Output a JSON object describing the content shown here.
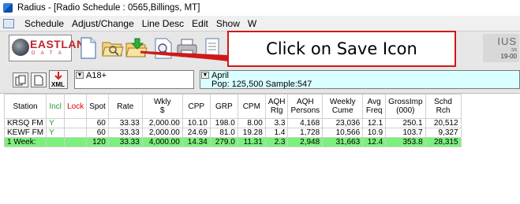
{
  "window": {
    "title": "Radius  - [Radio Schedule : 0565,Billings, MT]"
  },
  "menu": [
    "Schedule",
    "Adjust/Change",
    "Line Desc",
    "Edit",
    "Show",
    "W"
  ],
  "toolbar": {
    "logo_name": "EASTLAN",
    "logo_sub": "D A T A",
    "right_logo_l1": "IUS",
    "right_logo_l2": "ss",
    "right_logo_l3": "19-00",
    "icons": [
      "new-document-icon",
      "open-folder-icon",
      "save-folder-icon",
      "print-preview-icon",
      "print-icon",
      "report-icon"
    ]
  },
  "callout": {
    "text": "Click on Save Icon",
    "color": "#d01818"
  },
  "filter": {
    "demo": "A18+",
    "period": "April",
    "population": "Pop: 125,500   Sample:547"
  },
  "table": {
    "columns": [
      "Station",
      "Incl",
      "Lock",
      "Spot",
      "Rate",
      "Wkly\n$",
      "CPP",
      "GRP",
      "CPM",
      "AQH\nRtg",
      "AQH\nPersons",
      "Weekly\nCume",
      "Avg\nFreq",
      "GrossImp\n(000)",
      "Schd\nRch"
    ],
    "rows": [
      [
        "KRSQ FM",
        "Y",
        "",
        "60",
        "33.33",
        "2,000.00",
        "10.10",
        "198.0",
        "8.00",
        "3.3",
        "4,168",
        "23,036",
        "12.1",
        "250.1",
        "20,512"
      ],
      [
        "KEWF FM",
        "Y",
        "",
        "60",
        "33.33",
        "2,000.00",
        "24.69",
        "81.0",
        "19.28",
        "1.4",
        "1,728",
        "10,566",
        "10.9",
        "103.7",
        "9,327"
      ],
      [
        "1 Week:",
        "",
        "",
        "120",
        "33.33",
        "4,000.00",
        "14.34",
        "279.0",
        "11.31",
        "2.3",
        "2,948",
        "31,663",
        "12.4",
        "353.8",
        "28,315"
      ]
    ],
    "total_row_color": "#7cf07c"
  }
}
